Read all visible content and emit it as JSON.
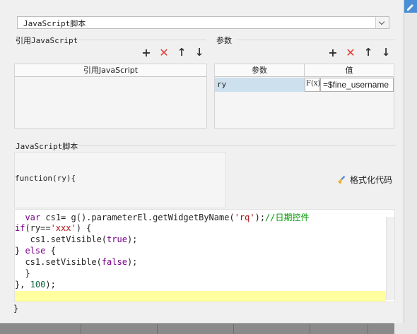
{
  "script_type_combo": {
    "value": "JavaScript脚本"
  },
  "referenced_js": {
    "title": "引用JavaScript",
    "column_header": "引用JavaScript"
  },
  "params": {
    "title": "参数",
    "col_param": "参数",
    "col_value": "值",
    "rows": [
      {
        "name": "ry",
        "formula_label": "F(x)",
        "value": "=$fine_username"
      }
    ]
  },
  "js_script": {
    "title": "JavaScript脚本",
    "function_header": "function(ry){",
    "format_button": "格式化代码",
    "closing": "}"
  },
  "code_lines": [
    "  var cs1= g().parameterEl.getWidgetByName('rq');//日期控件",
    "if(ry=='xxx') {",
    "   cs1.setVisible(true);",
    "} else {",
    "  cs1.setVisible(false);",
    "  }",
    "}, 100);"
  ],
  "colors": {
    "keyword": "#770088",
    "string": "#aa1111",
    "number": "#116644",
    "comment": "#009900",
    "highlight": "#ffff9f",
    "delete": "#e03c31"
  },
  "icons": [
    "plus-icon",
    "delete-icon",
    "arrow-up-icon",
    "arrow-down-icon",
    "broom-icon",
    "chevron-down-icon"
  ]
}
